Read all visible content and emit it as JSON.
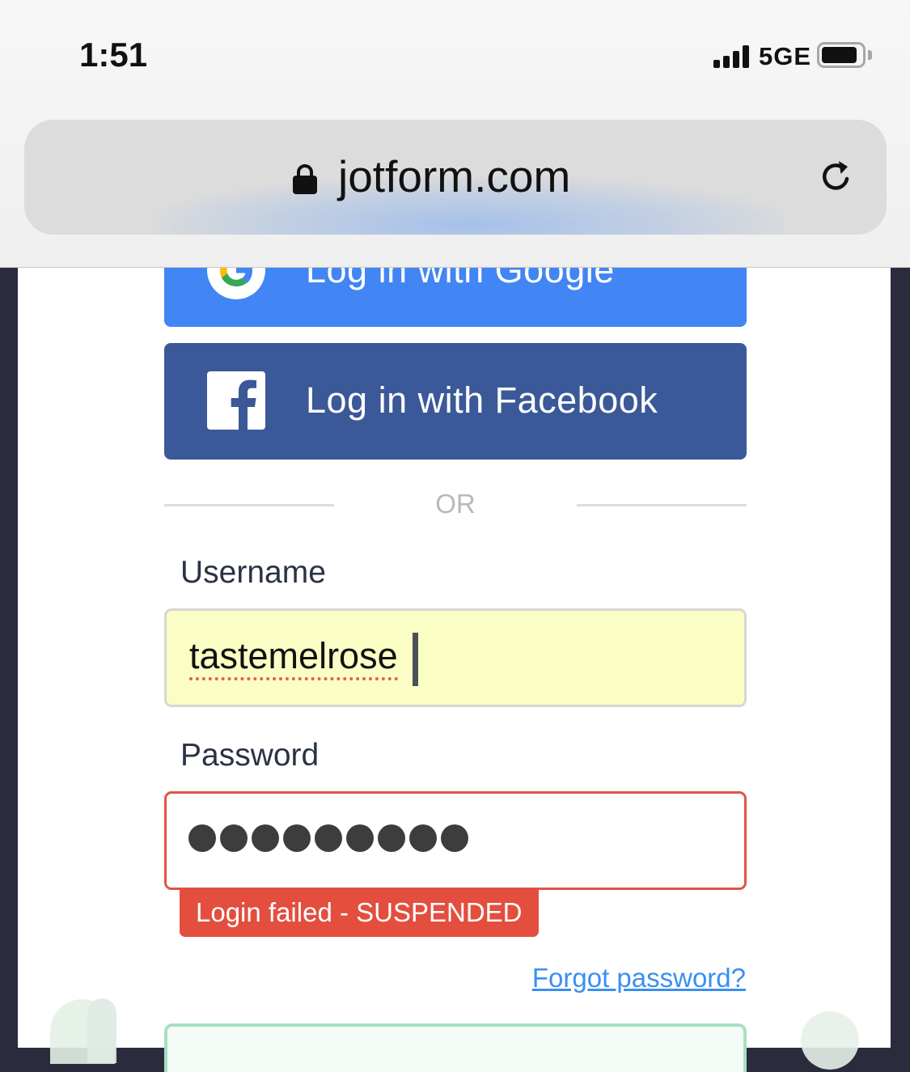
{
  "status_bar": {
    "time": "1:51",
    "network": "5GE",
    "battery_level": 0.9
  },
  "browser": {
    "url": "jotform.com",
    "lock_icon": "lock-icon",
    "reload_icon": "reload-icon"
  },
  "login": {
    "google_label": "Log in with Google",
    "facebook_label": "Log in with Facebook",
    "divider_text": "OR",
    "username_label": "Username",
    "username_value": "tastemelrose",
    "password_label": "Password",
    "password_mask_length": 9,
    "error_message": "Login failed - SUSPENDED",
    "forgot_password": "Forgot password?"
  },
  "colors": {
    "google_blue": "#4285f4",
    "facebook_blue": "#3b5998",
    "error_red": "#e34e3e",
    "autofill_yellow": "#fafdc4",
    "link_blue": "#3a8ff0"
  }
}
